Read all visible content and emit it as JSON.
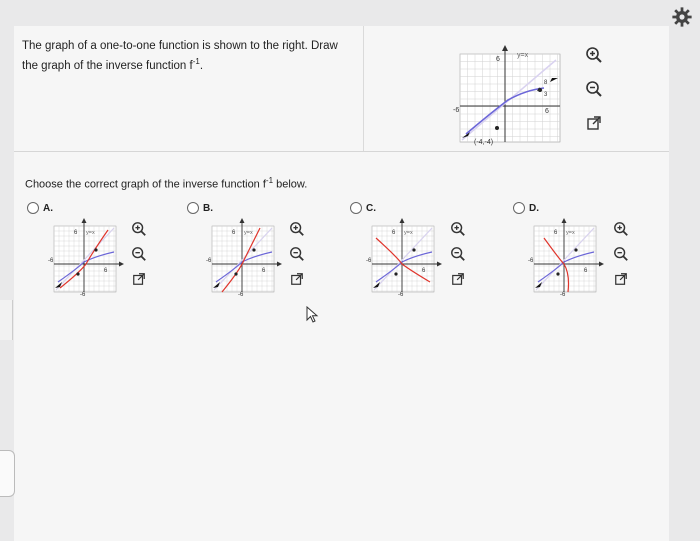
{
  "question": {
    "text_before": "The graph of a one-to-one function is shown to the right. Draw the graph of the inverse function f",
    "superscript": "-1",
    "text_after": "."
  },
  "main_graph": {
    "line_label": "y=x",
    "tick_6": "6",
    "tick_neg6": "-6",
    "point_a": "(4, 8/3)",
    "point_b": "(-4,-4)",
    "point_a_x": "4",
    "point_a_num": "8",
    "point_a_den": "3",
    "point_b_label": "(-4,-4)"
  },
  "choose": {
    "text_before": "Choose the correct graph of the inverse function f",
    "superscript": "-1",
    "text_after": " below."
  },
  "options": [
    {
      "label": "A.",
      "selected": false
    },
    {
      "label": "B.",
      "selected": false
    },
    {
      "label": "C.",
      "selected": false
    },
    {
      "label": "D.",
      "selected": false
    }
  ],
  "small_graph": {
    "line_label": "y=x",
    "tick_6": "6",
    "tick_neg6": "-6"
  },
  "colors": {
    "curve": "#6b66d8",
    "inverse": "#e0352c",
    "identity": "#d8d2ee",
    "grid": "#cfcfcf",
    "axis": "#333333"
  },
  "icons": [
    "zoom-in-icon",
    "zoom-out-icon",
    "external-link-icon",
    "gear-icon"
  ]
}
